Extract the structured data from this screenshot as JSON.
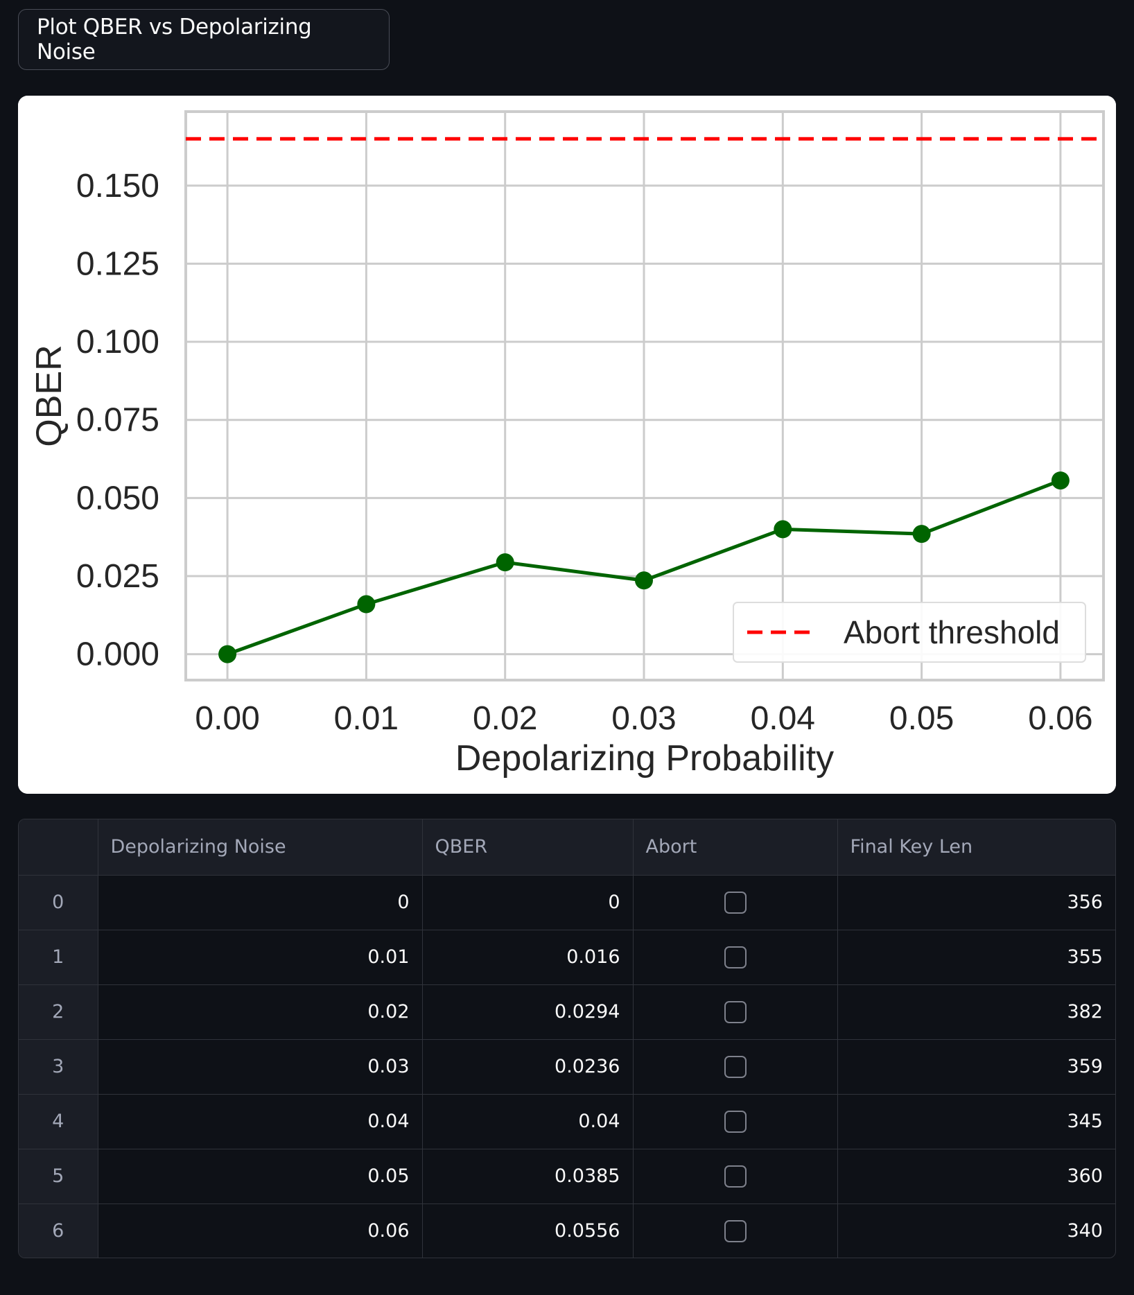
{
  "button": {
    "label": "Plot QBER vs Depolarizing Noise"
  },
  "chart_data": {
    "type": "line",
    "xlabel": "Depolarizing Probability",
    "ylabel": "QBER",
    "x": [
      0.0,
      0.01,
      0.02,
      0.03,
      0.04,
      0.05,
      0.06
    ],
    "x_tick_labels": [
      "0.00",
      "0.01",
      "0.02",
      "0.03",
      "0.04",
      "0.05",
      "0.06"
    ],
    "y_tick_values": [
      0.0,
      0.025,
      0.05,
      0.075,
      0.1,
      0.125,
      0.15
    ],
    "y_tick_labels": [
      "0.000",
      "0.025",
      "0.050",
      "0.075",
      "0.100",
      "0.125",
      "0.150"
    ],
    "xlim": [
      -0.003,
      0.0631
    ],
    "ylim": [
      -0.0083,
      0.1737
    ],
    "grid": true,
    "series": [
      {
        "values": [
          0.0,
          0.016,
          0.0294,
          0.0236,
          0.04,
          0.0385,
          0.0556
        ],
        "color": "#006400",
        "style": "solid line with circle markers"
      }
    ],
    "reference_lines": [
      {
        "name": "Abort threshold",
        "y": 0.165,
        "color": "#ff0000",
        "style": "dashed"
      }
    ],
    "legend": {
      "placement": "lower-right",
      "entries": [
        "Abort threshold"
      ]
    }
  },
  "table": {
    "columns": [
      "",
      "Depolarizing Noise",
      "QBER",
      "Abort",
      "Final Key Len"
    ],
    "rows": [
      {
        "index": "0",
        "noise": "0",
        "qber": "0",
        "abort": false,
        "key_len": "356"
      },
      {
        "index": "1",
        "noise": "0.01",
        "qber": "0.016",
        "abort": false,
        "key_len": "355"
      },
      {
        "index": "2",
        "noise": "0.02",
        "qber": "0.0294",
        "abort": false,
        "key_len": "382"
      },
      {
        "index": "3",
        "noise": "0.03",
        "qber": "0.0236",
        "abort": false,
        "key_len": "359"
      },
      {
        "index": "4",
        "noise": "0.04",
        "qber": "0.04",
        "abort": false,
        "key_len": "345"
      },
      {
        "index": "5",
        "noise": "0.05",
        "qber": "0.0385",
        "abort": false,
        "key_len": "360"
      },
      {
        "index": "6",
        "noise": "0.06",
        "qber": "0.0556",
        "abort": false,
        "key_len": "340"
      }
    ]
  }
}
